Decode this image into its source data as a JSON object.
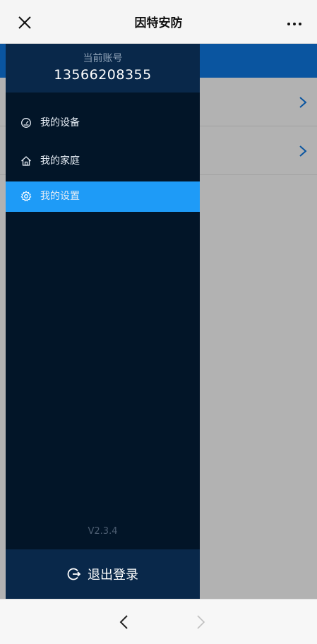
{
  "header": {
    "title": "因特安防",
    "close_icon": "close-icon",
    "more_icon": "more-dots-icon"
  },
  "drawer": {
    "account_label": "当前账号",
    "account_phone": "13566208355",
    "menu": [
      {
        "label": "我的设备",
        "icon": "gauge-icon",
        "active": false
      },
      {
        "label": "我的家庭",
        "icon": "home-icon",
        "active": false
      },
      {
        "label": "我的设置",
        "icon": "gear-icon",
        "active": true
      }
    ],
    "version": "V2.3.4",
    "logout_label": "退出登录",
    "logout_icon": "logout-icon"
  },
  "bottom_nav": {
    "back_icon": "chevron-left-icon",
    "forward_icon": "chevron-right-icon"
  },
  "colors": {
    "drawer_bg": "#021528",
    "drawer_header_bg": "#09284a",
    "active_item": "#1e9bf7",
    "accent": "#0f7ae5"
  }
}
